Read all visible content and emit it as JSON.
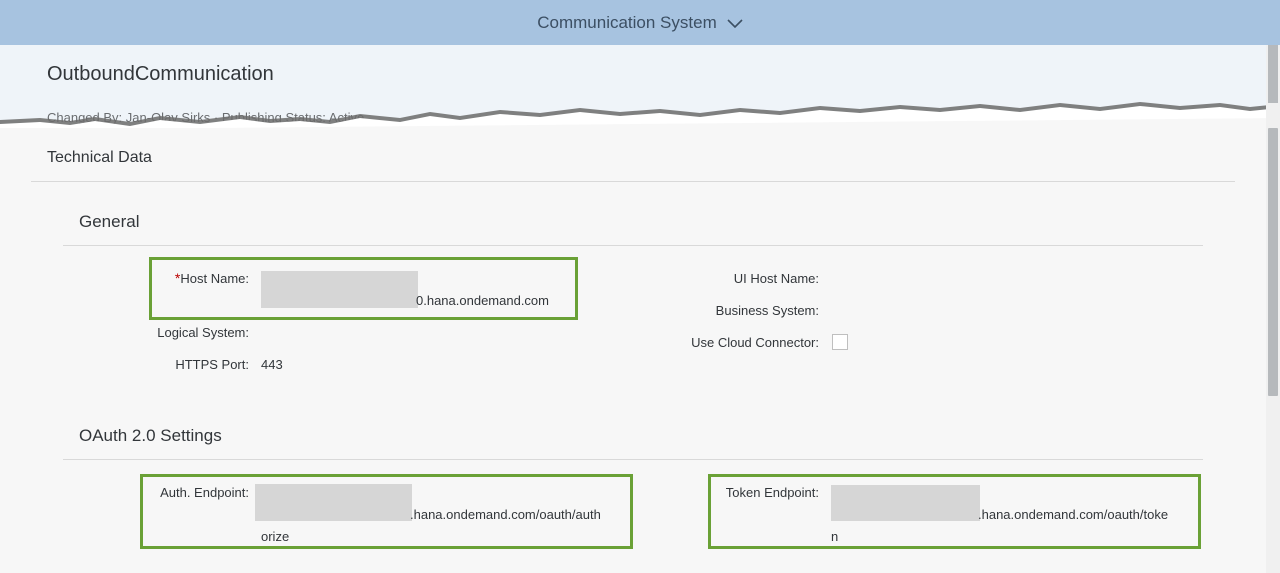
{
  "shell": {
    "title": "Communication System",
    "chevron_icon": "chevron-down-icon"
  },
  "header": {
    "title": "OutboundCommunication",
    "attributes": "Changed By: Jan-Olav Sirks · Publishing Status: Active"
  },
  "technical": {
    "title": "Technical Data",
    "general": {
      "title": "General",
      "host_name_label": "Host Name:",
      "required_marker": "*",
      "host_name_value": "0.hana.ondemand.com",
      "logical_system_label": "Logical System:",
      "https_port_label": "HTTPS Port:",
      "https_port_value": "443",
      "ui_host_label": "UI Host Name:",
      "business_system_label": "Business System:",
      "cloud_connector_label": "Use Cloud Connector:"
    },
    "oauth": {
      "title": "OAuth 2.0 Settings",
      "auth_endpoint_label": "Auth. Endpoint:",
      "auth_endpoint_line1": ".hana.ondemand.com/oauth/auth",
      "auth_endpoint_line2": "orize",
      "token_endpoint_label": "Token Endpoint:",
      "token_endpoint_line1": ".hana.ondemand.com/oauth/toke",
      "token_endpoint_line2": "n"
    }
  },
  "colors": {
    "shell_bg": "#a7c3e0",
    "highlight": "#6aa136",
    "required": "#bb0000"
  }
}
